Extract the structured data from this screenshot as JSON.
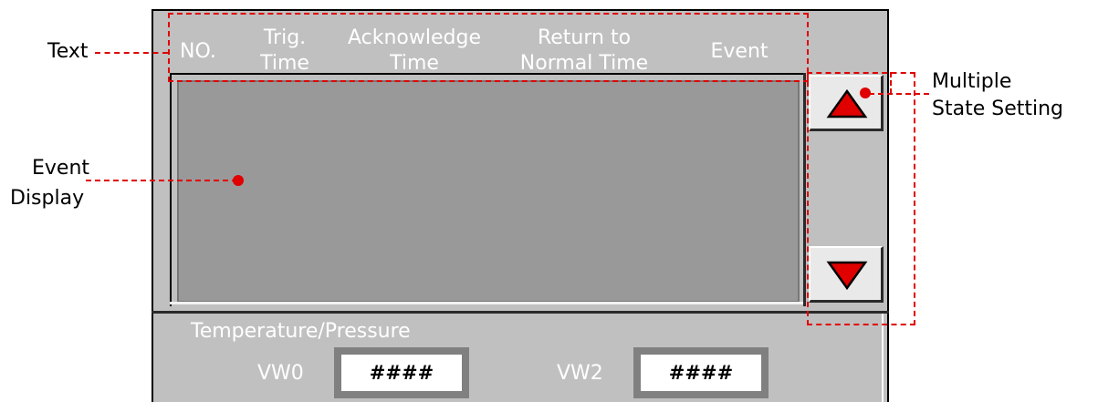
{
  "header": {
    "no": "NO.",
    "trig_line1": "Trig.",
    "trig_line2": "Time",
    "ack_line1": "Acknowledge",
    "ack_line2": "Time",
    "rtn_line1": "Return to",
    "rtn_line2": "Normal Time",
    "event": "Event"
  },
  "scroll": {
    "up_icon": "triangle-up-icon",
    "down_icon": "triangle-down-icon",
    "arrow_color": "#e00000"
  },
  "monitor": {
    "title": "Temperature/Pressure",
    "var1_label": "VW0",
    "var1_value": "####",
    "var2_label": "VW2",
    "var2_value": "####"
  },
  "annotations": {
    "text": "Text",
    "event_display_line1": "Event",
    "event_display_line2": "Display",
    "multiple_line1": "Multiple",
    "multiple_line2": "State Setting",
    "marker_color": "#e00000"
  }
}
